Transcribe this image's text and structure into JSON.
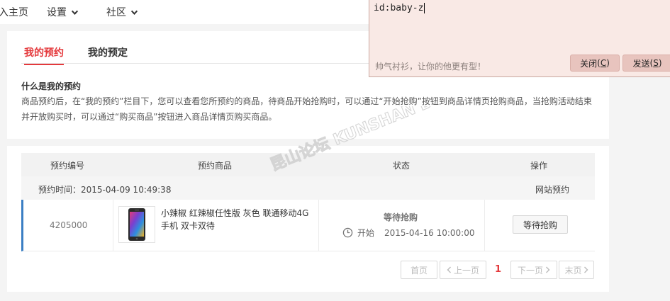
{
  "nav": {
    "home": "入主页",
    "settings": "设置",
    "community": "社区"
  },
  "tabs": {
    "reservations": "我的预约",
    "bookings": "我的预定"
  },
  "help": {
    "title": "什么是我的预约",
    "text": "商品预约后，在“我的预约”栏目下，您可以查看您所预约的商品，待商品开始抢购时，可以通过“开始抢购”按钮到商品详情页抢购商品，当抢购活动结束并开放购买时，可以通过“购买商品”按钮进入商品详情页购买商品。"
  },
  "table": {
    "headers": {
      "order_no": "预约编号",
      "product": "预约商品",
      "status": "状态",
      "action": "操作"
    },
    "group": {
      "time": "预约时间：2015-04-09 10:49:38",
      "channel": "网站预约"
    },
    "rows": [
      {
        "order_no": "4205000",
        "product_name": "小辣椒 红辣椒任性版 灰色 联通移动4G手机 双卡双待",
        "status_title": "等待抢购",
        "start_label": "开始",
        "start_time": "2015-04-16 10:00:00",
        "action_label": "等待抢购"
      }
    ]
  },
  "pagination": {
    "first": "首页",
    "prev": "上一页",
    "current": "1",
    "next": "下一页",
    "last": "末页"
  },
  "watermark": {
    "text": "昆山论坛 KUNSHAN BBS"
  },
  "chat": {
    "input_value": "id:baby-z",
    "hint": "帅气衬衫，让你的他更有型！",
    "close_label": "关闭",
    "close_key": "C",
    "send_label": "发送",
    "send_key": "S"
  },
  "colors": {
    "accent": "#e4393c",
    "row_marker": "#3b7fc4",
    "chat_bg": "#f9e9e5",
    "chat_button": "#e8c4be"
  }
}
